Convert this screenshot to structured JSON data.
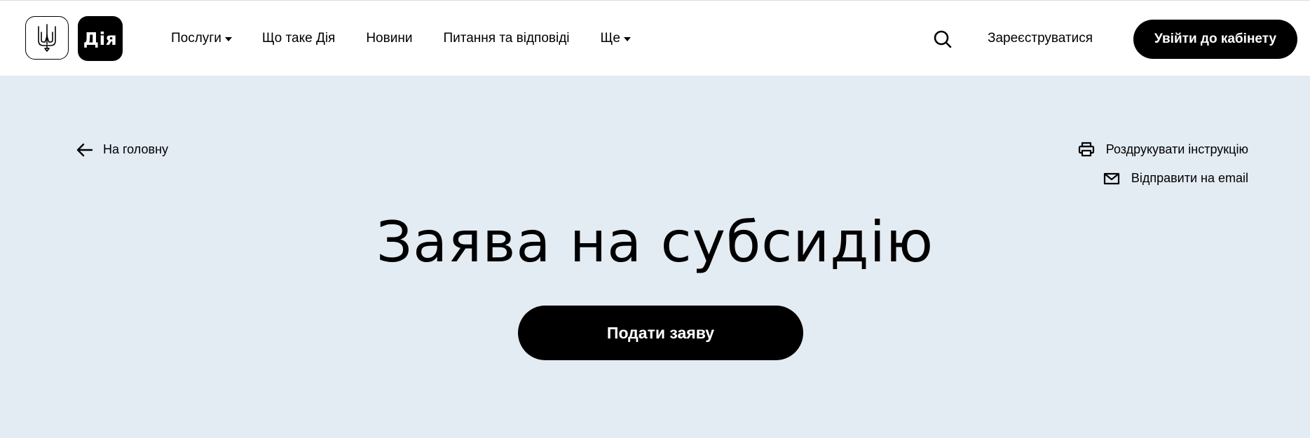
{
  "header": {
    "logo_text": "Дія",
    "nav": [
      {
        "label": "Послуги",
        "dropdown": true
      },
      {
        "label": "Що таке Дія",
        "dropdown": false
      },
      {
        "label": "Новини",
        "dropdown": false
      },
      {
        "label": "Питання та відповіді",
        "dropdown": false
      },
      {
        "label": "Ще",
        "dropdown": true
      }
    ],
    "register_label": "Зареєструватися",
    "login_label": "Увійти до кабінету"
  },
  "page": {
    "back_label": "На головну",
    "print_label": "Роздрукувати інструкцію",
    "email_label": "Відправити на email",
    "title": "Заява на субсидію",
    "submit_label": "Подати заяву"
  },
  "icons": {
    "logo": "trident-icon",
    "search": "search-icon",
    "back": "arrow-left-icon",
    "print": "printer-icon",
    "email": "envelope-icon"
  },
  "colors": {
    "background": "#e3ebf3",
    "header": "#ffffff",
    "primary": "#000000",
    "primary_text": "#ffffff"
  }
}
